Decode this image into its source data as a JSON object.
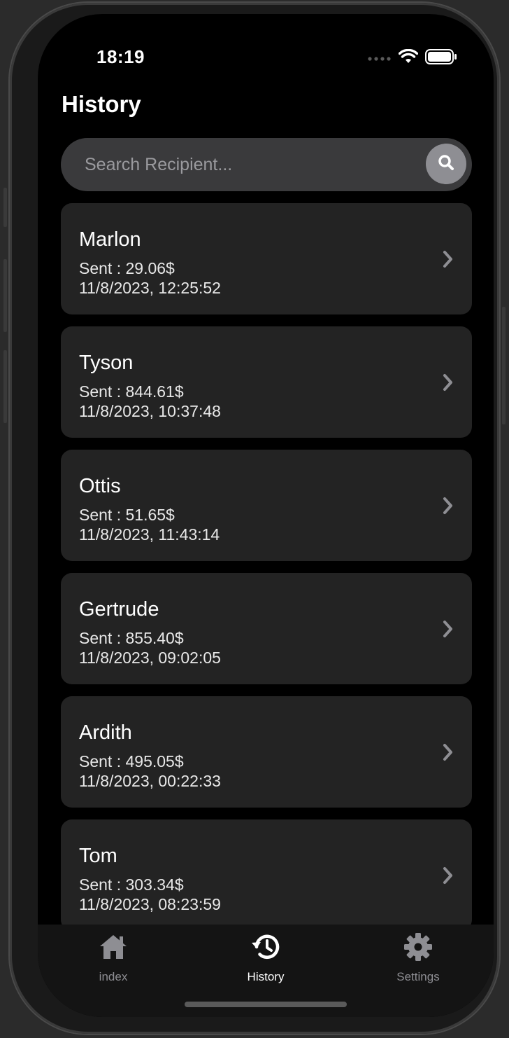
{
  "status_bar": {
    "time": "18:19"
  },
  "header": {
    "title": "History"
  },
  "search": {
    "placeholder": "Search Recipient...",
    "value": ""
  },
  "transactions": [
    {
      "name": "Marlon",
      "amount": "Sent : 29.06$",
      "date": "11/8/2023, 12:25:52"
    },
    {
      "name": "Tyson",
      "amount": "Sent : 844.61$",
      "date": "11/8/2023, 10:37:48"
    },
    {
      "name": "Ottis",
      "amount": "Sent : 51.65$",
      "date": "11/8/2023, 11:43:14"
    },
    {
      "name": "Gertrude",
      "amount": "Sent : 855.40$",
      "date": "11/8/2023, 09:02:05"
    },
    {
      "name": "Ardith",
      "amount": "Sent : 495.05$",
      "date": "11/8/2023, 00:22:33"
    },
    {
      "name": "Tom",
      "amount": "Sent : 303.34$",
      "date": "11/8/2023, 08:23:59"
    }
  ],
  "tabs": [
    {
      "label": "index",
      "icon": "home-icon",
      "active": false
    },
    {
      "label": "History",
      "icon": "history-icon",
      "active": true
    },
    {
      "label": "Settings",
      "icon": "gear-icon",
      "active": false
    }
  ],
  "colors": {
    "background": "#000000",
    "card": "#232323",
    "search_bg": "#3a3a3c",
    "search_button": "#8e8e93",
    "active_tab": "#ffffff",
    "inactive_tab": "#8e8e93"
  }
}
